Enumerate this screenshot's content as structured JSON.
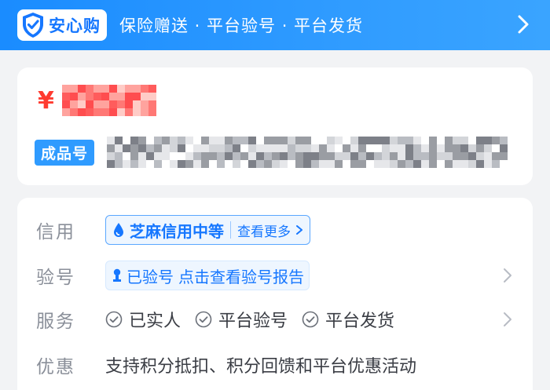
{
  "banner": {
    "badge_label": "安心购",
    "slogan": "保险赠送 · 平台验号 · 平台发货"
  },
  "listing": {
    "currency_symbol": "¥",
    "product_tag": "成品号"
  },
  "details": {
    "credit": {
      "label": "信用",
      "level": "芝麻信用中等",
      "more": "查看更多"
    },
    "verify": {
      "label": "验号",
      "status": "已验号",
      "report_link": "点击查看验号报告"
    },
    "service": {
      "label": "服务",
      "items": [
        "已实人",
        "平台验号",
        "平台发货"
      ]
    },
    "promo": {
      "label": "优惠",
      "text": "支持积分抵扣、积分回馈和平台优惠活动"
    }
  },
  "colors": {
    "accent": "#1677ff",
    "price": "#ff3b30",
    "banner_gradient_start": "#1a8cff",
    "banner_gradient_end": "#3aa4ff"
  },
  "icons": {
    "badge": "shield-check-icon",
    "banner_arrow": "chevron-right-icon",
    "credit": "water-drop-icon",
    "verify": "person-icon",
    "service_item": "check-circle-icon"
  }
}
